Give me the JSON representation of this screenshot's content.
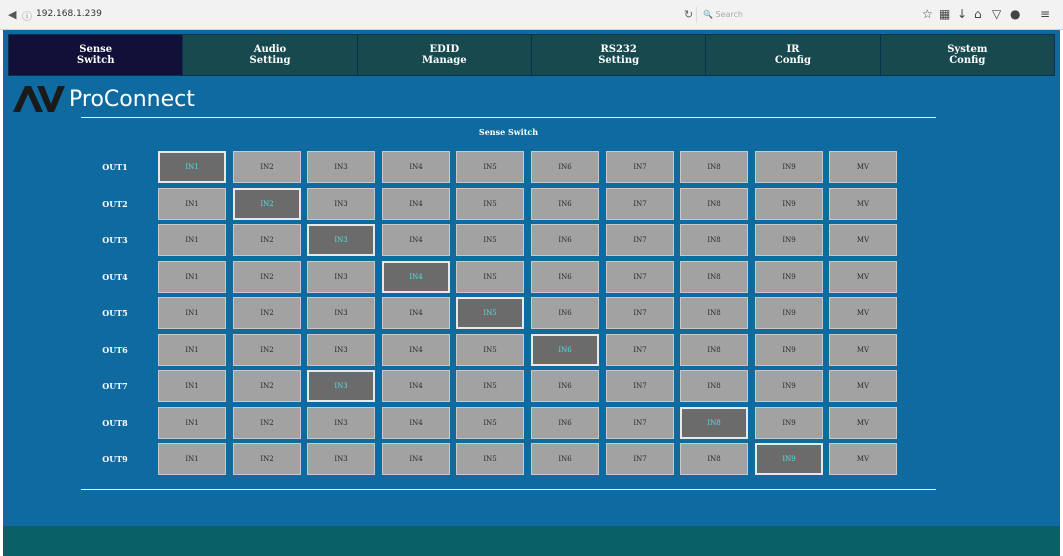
{
  "browser": {
    "url": "192.168.1.239",
    "search_placeholder": "Search",
    "icons": [
      "back-icon",
      "info-icon",
      "reload-icon",
      "search-icon",
      "star-icon",
      "reading-list-icon",
      "download-icon",
      "home-icon",
      "pocket-icon",
      "extension-icon",
      "menu-icon"
    ]
  },
  "nav": {
    "tabs": [
      {
        "line1": "Sense",
        "line2": "Switch",
        "active": true
      },
      {
        "line1": "Audio",
        "line2": "Setting",
        "active": false
      },
      {
        "line1": "EDID",
        "line2": "Manage",
        "active": false
      },
      {
        "line1": "RS232",
        "line2": "Setting",
        "active": false
      },
      {
        "line1": "IR",
        "line2": "Config",
        "active": false
      },
      {
        "line1": "System",
        "line2": "Config",
        "active": false
      }
    ]
  },
  "logo": {
    "text": "ProConnect",
    "mark": "AV"
  },
  "section_title": "Sense Switch",
  "matrix": {
    "rows": [
      "OUT1",
      "OUT2",
      "OUT3",
      "OUT4",
      "OUT5",
      "OUT6",
      "OUT7",
      "OUT8",
      "OUT9"
    ],
    "columns": [
      "IN1",
      "IN2",
      "IN3",
      "IN4",
      "IN5",
      "IN6",
      "IN7",
      "IN8",
      "IN9",
      "MV"
    ],
    "selected": [
      0,
      1,
      2,
      3,
      4,
      5,
      2,
      7,
      8
    ]
  },
  "footer": {
    "line1": "",
    "line2": ""
  },
  "colors": {
    "page_bg": "#0f6aa0",
    "nav_bg": "#17494f",
    "nav_active": "#101038",
    "button": "#a2a2a2",
    "button_selected": "#6b6b6b",
    "selected_text": "#4fe0e0",
    "footer_bg": "#0a6165"
  }
}
